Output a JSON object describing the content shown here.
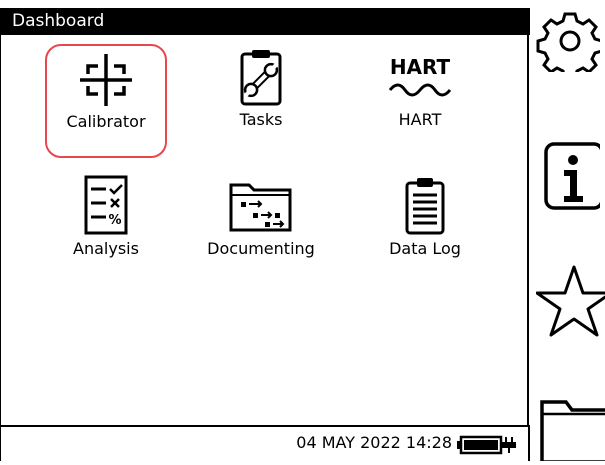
{
  "header": {
    "title": "Dashboard"
  },
  "tiles": [
    {
      "label": "Calibrator",
      "icon": "calibrator-crosshair-icon",
      "selected": true
    },
    {
      "label": "Tasks",
      "icon": "tasks-clipboard-wrench-icon"
    },
    {
      "label": "HART",
      "icon": "hart-wave-icon",
      "logo_text": "HART"
    },
    {
      "label": "Analysis",
      "icon": "analysis-checklist-icon"
    },
    {
      "label": "Documenting",
      "icon": "documenting-folder-icon"
    },
    {
      "label": "Data Log",
      "icon": "data-log-clipboard-icon"
    }
  ],
  "status": {
    "datetime": "04 MAY 2022 14:28",
    "battery_level": 1.0
  },
  "side_buttons": [
    {
      "icon": "settings-gear-icon"
    },
    {
      "icon": "info-icon"
    },
    {
      "icon": "favorites-star-icon"
    },
    {
      "icon": "folder-icon"
    }
  ],
  "colors": {
    "selection": "#e8474d",
    "titlebar": "#000000"
  }
}
